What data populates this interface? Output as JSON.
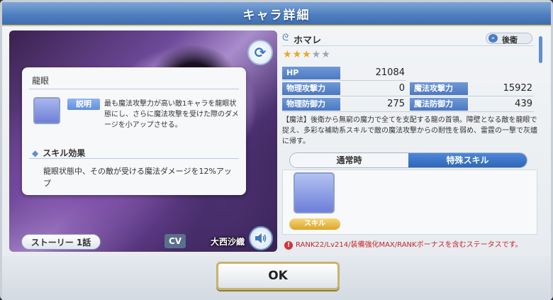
{
  "window": {
    "title": "キャラ詳細"
  },
  "character": {
    "name": "ホマレ",
    "position": "後衛",
    "stars_filled": 3,
    "stars_total": 5,
    "profile": "【魔法】後衛から無窮の魔力で全てを支配する龍の首領。障壁となる敵を龍眼で捉え、多彩な補助系スキルで敵の魔法攻撃からの耐性を弱め、雷霆の一撃で灰燼に帰す。"
  },
  "stats": {
    "hp": {
      "label": "HP",
      "value": "21084"
    },
    "phys_atk": {
      "label": "物理攻撃力",
      "value": "0"
    },
    "mag_atk": {
      "label": "魔法攻撃力",
      "value": "15922"
    },
    "phys_def": {
      "label": "物理防御力",
      "value": "275"
    },
    "mag_def": {
      "label": "魔法防御力",
      "value": "439"
    }
  },
  "art": {
    "story_button": "ストーリー 1話",
    "cv_label": "CV",
    "cv_name": "大西沙織"
  },
  "tabs": [
    {
      "label": "通常時",
      "active": false
    },
    {
      "label": "特殊スキル",
      "active": true
    }
  ],
  "skill_tag": "スキル",
  "popup": {
    "title": "龍眼",
    "desc_tag": "説明",
    "description": "最も魔法攻撃力が高い敵1キャラを龍眼状態にし、さらに魔法攻撃を受けた際のダメージを小アップさせる。",
    "effect_heading": "スキル効果",
    "effect_text": "龍眼状態中、その敵が受ける魔法ダメージを12%アップ"
  },
  "warning": "RANK22/Lv214/装備強化MAX/RANKボーナスを含むステータスです。",
  "ok_button": "OK",
  "colors": {
    "accent": "#4c78c0",
    "warning": "#c8242a",
    "ok_border": "#c9b36b"
  },
  "icons": [
    "refresh-icon",
    "speaker-icon",
    "chevron-right-icon",
    "warning-icon",
    "skill-dragon-eye-icon"
  ]
}
